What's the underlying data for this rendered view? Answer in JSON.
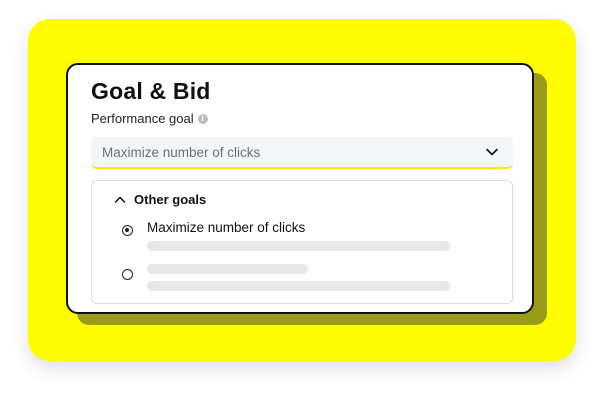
{
  "card": {
    "title": "Goal & Bid",
    "subtitle": "Performance goal",
    "info_icon": "i"
  },
  "dropdown": {
    "selected_value": "Maximize number of clicks",
    "icon": "chevron-down-icon"
  },
  "options_panel": {
    "group_label": "Other goals",
    "group_icon": "chevron-up-icon",
    "options": [
      {
        "label": "Maximize number of clicks",
        "selected": true
      },
      {
        "label": "",
        "selected": false
      }
    ]
  },
  "colors": {
    "accent_yellow": "#FFFC00",
    "border_dark": "#111111",
    "field_bg": "#f4f5f7",
    "skeleton": "#e6e7e9"
  }
}
